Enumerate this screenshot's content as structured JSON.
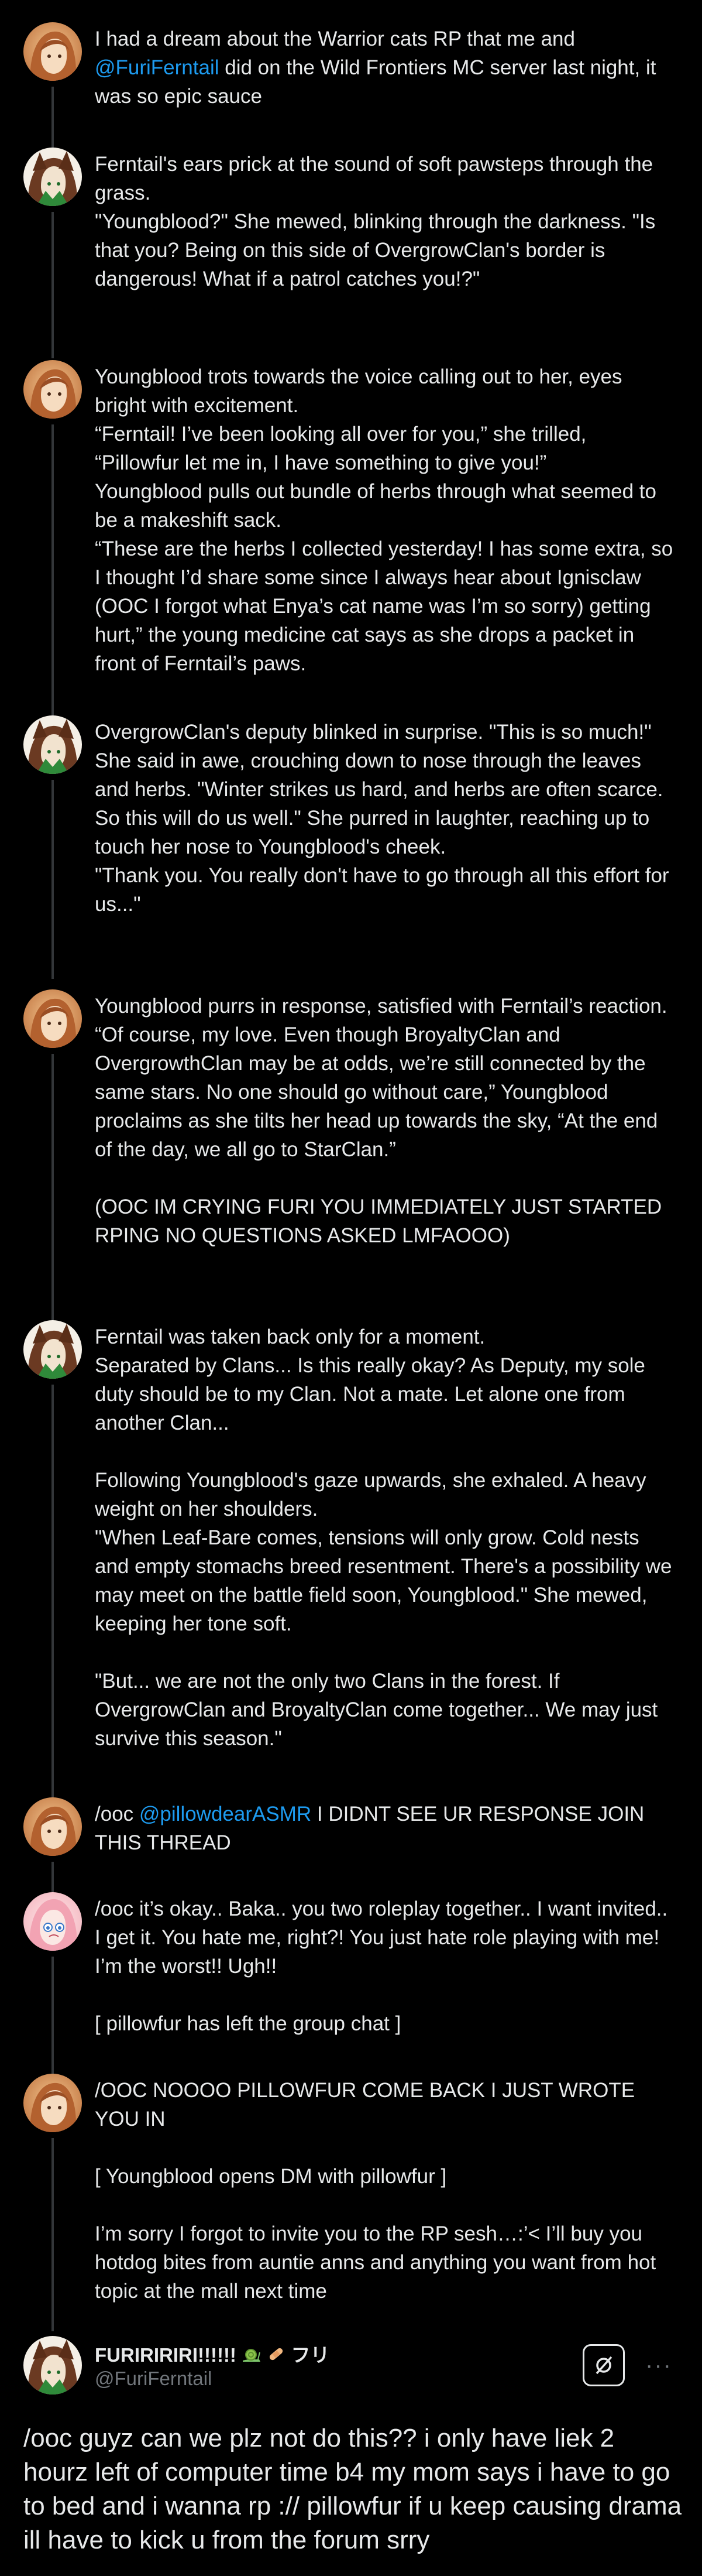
{
  "posts": [
    {
      "avatar": "youngblood-avatar",
      "paragraphs": [
        {
          "before": "I had a dream about the Warrior cats RP that me and ",
          "mention": "@FuriFerntail",
          "after": " did on the Wild Frontiers MC server last night, it was so epic sauce"
        }
      ]
    },
    {
      "avatar": "ferntail-avatar",
      "paragraphs": [
        {
          "text": "Ferntail's ears prick at the sound of soft pawsteps through the grass.\n\"Youngblood?\" She mewed, blinking through the darkness. \"Is that you? Being on this side of OvergrowClan's border is dangerous! What if a patrol catches you!?\""
        }
      ]
    },
    {
      "avatar": "youngblood-avatar",
      "paragraphs": [
        {
          "text": "Youngblood trots towards the voice calling out to her, eyes bright with excitement.\n“Ferntail! I’ve been looking all over for you,” she trilled, “Pillowfur let me in, I have something to give you!”\nYoungblood pulls out bundle of herbs through what seemed to be a makeshift sack.\n“These are the herbs I collected yesterday! I has some extra, so I thought I’d share some since I always hear about Ignisclaw (OOC I forgot what Enya’s cat name was I’m so sorry) getting hurt,” the young medicine cat says as she drops a packet in front of Ferntail’s paws."
        }
      ]
    },
    {
      "avatar": "ferntail-avatar",
      "paragraphs": [
        {
          "text": "OvergrowClan's deputy blinked in surprise. \"This is so much!\" She said in awe, crouching down to nose through the leaves and herbs. \"Winter strikes us hard, and herbs are often scarce. So this will do us well.\" She purred in laughter, reaching up to touch her nose to Youngblood's cheek.\n\"Thank you. You really don't have to go through all this effort for us...\""
        }
      ]
    },
    {
      "avatar": "youngblood-avatar",
      "paragraphs": [
        {
          "text": "Youngblood purrs in response, satisfied with Ferntail’s reaction. “Of course, my love. Even though BroyaltyClan and OvergrowthClan may be at odds, we’re still connected by the same stars. No one should go without care,” Youngblood proclaims as she tilts her head up towards the sky, “At the end of the day, we all go to StarClan.”"
        },
        {
          "text": "(OOC IM CRYING FURI YOU IMMEDIATELY JUST STARTED RPING NO QUESTIONS ASKED LMFAOOO)"
        }
      ]
    },
    {
      "avatar": "ferntail-avatar",
      "paragraphs": [
        {
          "text": "Ferntail was taken back only for a moment.\nSeparated by Clans... Is this really okay? As Deputy, my sole duty should be to my Clan. Not a mate. Let alone one from another Clan..."
        },
        {
          "text": "Following Youngblood's gaze upwards, she exhaled. A heavy weight on her shoulders.\n\"When Leaf-Bare comes, tensions will only grow. Cold nests and empty stomachs breed resentment. There's a possibility we may meet on the battle field soon, Youngblood.\" She mewed, keeping her tone soft."
        },
        {
          "text": "\"But... we are not the only two Clans in the forest. If OvergrowClan and BroyaltyClan come together... We may just survive this season.\""
        }
      ]
    },
    {
      "avatar": "youngblood-avatar",
      "paragraphs": [
        {
          "before": "/ooc ",
          "mention": "@pillowdearASMR",
          "after": " I DIDNT SEE UR RESPONSE JOIN THIS THREAD"
        }
      ]
    },
    {
      "avatar": "pillowfur-avatar",
      "paragraphs": [
        {
          "text": "/ooc it’s okay.. Baka.. you two roleplay together.. I want invited.. I get it. You hate me, right?! You just hate role playing with me! I’m the worst!! Ugh!!"
        },
        {
          "text": "[ pillowfur has left the group chat ]"
        }
      ]
    },
    {
      "avatar": "youngblood-avatar",
      "paragraphs": [
        {
          "text": "/OOC NOOOO PILLOWFUR COME BACK I JUST WROTE YOU IN"
        },
        {
          "text": "[ Youngblood opens DM with pillowfur ]"
        },
        {
          "text": "I’m sorry I forgot to invite you to the RP sesh…:’< I’ll buy you hotdog bites from auntie anns and anything you want from hot topic at the mall next time"
        }
      ]
    }
  ],
  "main_post": {
    "display_name": "FURIRIRIRI!!!!!!",
    "name_suffix": "フリ",
    "name_emojis": [
      "snail-emoji",
      "bandage-emoji"
    ],
    "handle": "@FuriFerntail",
    "grok_icon": "grok-icon",
    "more_icon": "more-icon",
    "more_label": "···",
    "text": "/ooc guyz can we plz not do this?? i only have liek 2 hourz left of computer time b4 my mom says i have to go to bed and i wanna rp :// pillowfur if u keep causing drama ill have to kick u from the forum srry"
  },
  "colors": {
    "background": "#000000",
    "text": "#e7e9ea",
    "secondary": "#71767b",
    "mention": "#1d9bf0",
    "thread_line": "#333639"
  }
}
